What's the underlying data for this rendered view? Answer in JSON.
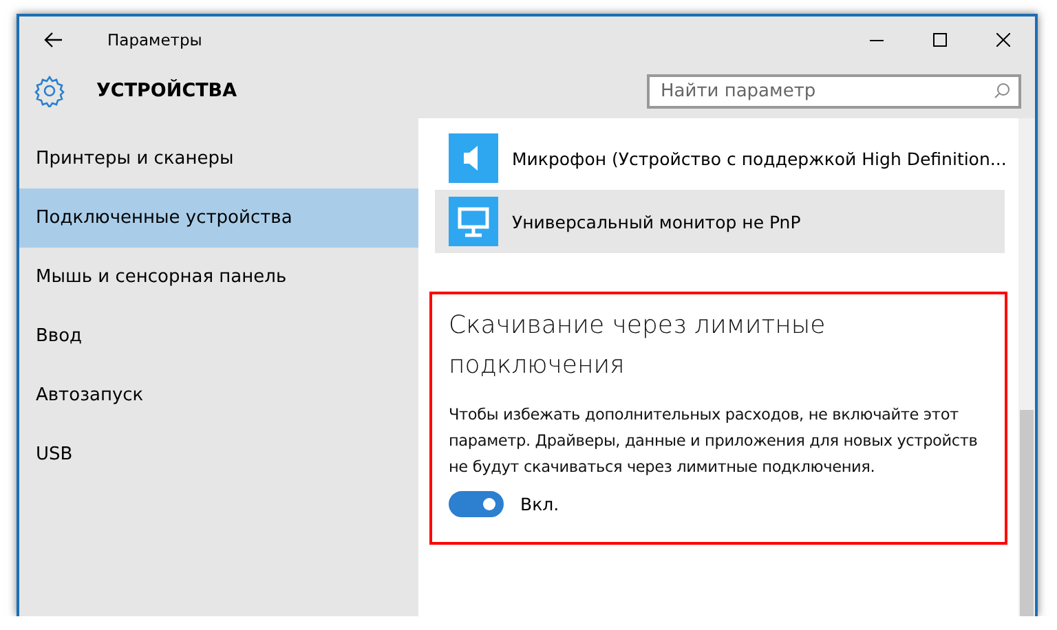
{
  "window": {
    "title": "Параметры"
  },
  "header": {
    "title": "УСТРОЙСТВА"
  },
  "search": {
    "placeholder": "Найти параметр"
  },
  "sidebar": {
    "items": [
      {
        "label": "Принтеры и сканеры",
        "selected": false
      },
      {
        "label": "Подключенные устройства",
        "selected": true
      },
      {
        "label": "Мышь и сенсорная панель",
        "selected": false
      },
      {
        "label": "Ввод",
        "selected": false
      },
      {
        "label": "Автозапуск",
        "selected": false
      },
      {
        "label": "USB",
        "selected": false
      }
    ]
  },
  "devices": [
    {
      "kind": "speaker",
      "name": "Микрофон (Устройство с поддержкой High Definition...",
      "selected": false
    },
    {
      "kind": "monitor",
      "name": "Универсальный монитор не PnP",
      "selected": true
    }
  ],
  "metered": {
    "heading": "Скачивание через лимитные подключения",
    "description": "Чтобы избежать дополнительных расходов, не включайте этот параметр. Драйверы, данные и приложения для новых устройств не будут скачиваться через лимитные подключения.",
    "toggle": {
      "on": true,
      "label": "Вкл."
    }
  }
}
